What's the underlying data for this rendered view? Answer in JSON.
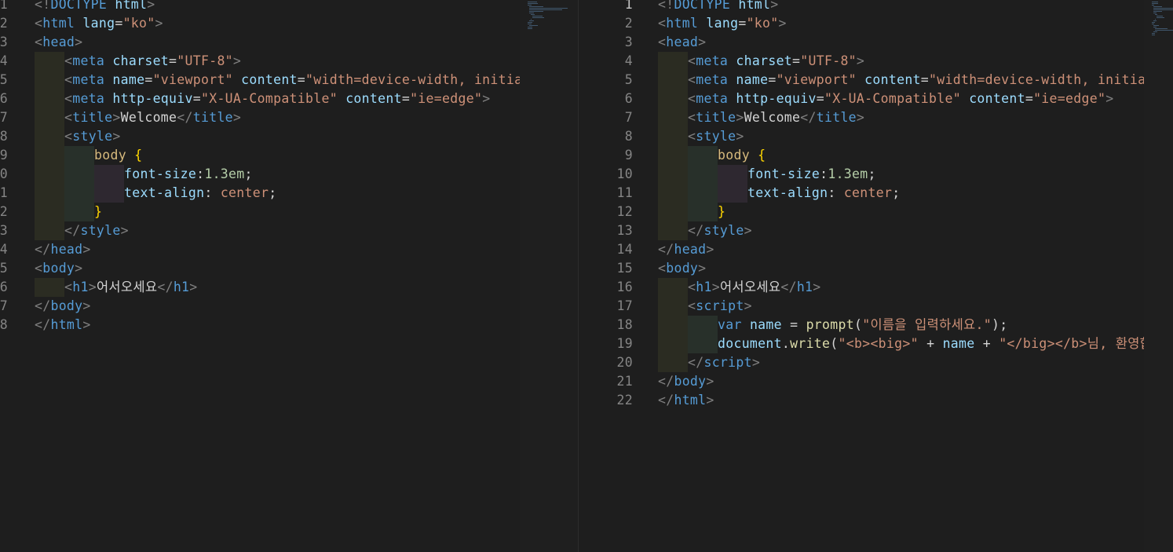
{
  "left_editor": {
    "lines": [
      {
        "no": "1",
        "indent": 0,
        "tokens": [
          [
            "t",
            "<!"
          ],
          [
            "n",
            "DOCTYPE"
          ],
          [
            "x",
            " "
          ],
          [
            "a",
            "html"
          ],
          [
            "t",
            ">"
          ]
        ]
      },
      {
        "no": "2",
        "indent": 0,
        "tokens": [
          [
            "t",
            "<"
          ],
          [
            "n",
            "html"
          ],
          [
            "x",
            " "
          ],
          [
            "a",
            "lang"
          ],
          [
            "x",
            "="
          ],
          [
            "s",
            "\"ko\""
          ],
          [
            "t",
            ">"
          ]
        ]
      },
      {
        "no": "3",
        "indent": 0,
        "tokens": [
          [
            "t",
            "<"
          ],
          [
            "n",
            "head"
          ],
          [
            "t",
            ">"
          ]
        ]
      },
      {
        "no": "4",
        "indent": 1,
        "tokens": [
          [
            "t",
            "<"
          ],
          [
            "n",
            "meta"
          ],
          [
            "x",
            " "
          ],
          [
            "a",
            "charset"
          ],
          [
            "x",
            "="
          ],
          [
            "s",
            "\"UTF-8\""
          ],
          [
            "t",
            ">"
          ]
        ]
      },
      {
        "no": "5",
        "indent": 1,
        "tokens": [
          [
            "t",
            "<"
          ],
          [
            "n",
            "meta"
          ],
          [
            "x",
            " "
          ],
          [
            "a",
            "name"
          ],
          [
            "x",
            "="
          ],
          [
            "s",
            "\"viewport\""
          ],
          [
            "x",
            " "
          ],
          [
            "a",
            "content"
          ],
          [
            "x",
            "="
          ],
          [
            "s",
            "\"width=device-width, initial-sc"
          ]
        ]
      },
      {
        "no": "6",
        "indent": 1,
        "tokens": [
          [
            "t",
            "<"
          ],
          [
            "n",
            "meta"
          ],
          [
            "x",
            " "
          ],
          [
            "a",
            "http-equiv"
          ],
          [
            "x",
            "="
          ],
          [
            "s",
            "\"X-UA-Compatible\""
          ],
          [
            "x",
            " "
          ],
          [
            "a",
            "content"
          ],
          [
            "x",
            "="
          ],
          [
            "s",
            "\"ie=edge\""
          ],
          [
            "t",
            ">"
          ]
        ]
      },
      {
        "no": "7",
        "indent": 1,
        "tokens": [
          [
            "t",
            "<"
          ],
          [
            "n",
            "title"
          ],
          [
            "t",
            ">"
          ],
          [
            "x",
            "Welcome"
          ],
          [
            "t",
            "</"
          ],
          [
            "n",
            "title"
          ],
          [
            "t",
            ">"
          ]
        ]
      },
      {
        "no": "8",
        "indent": 1,
        "tokens": [
          [
            "t",
            "<"
          ],
          [
            "n",
            "style"
          ],
          [
            "t",
            ">"
          ]
        ]
      },
      {
        "no": "9",
        "indent": 2,
        "tokens": [
          [
            "y",
            "body"
          ],
          [
            "x",
            " "
          ],
          [
            "b",
            "{"
          ]
        ]
      },
      {
        "no": "0",
        "indent": 3,
        "tokens": [
          [
            "a",
            "font-size"
          ],
          [
            "x",
            ":"
          ],
          [
            "m",
            "1.3em"
          ],
          [
            "x",
            ";"
          ]
        ]
      },
      {
        "no": "1",
        "indent": 3,
        "tokens": [
          [
            "a",
            "text-align"
          ],
          [
            "x",
            ": "
          ],
          [
            "s",
            "center"
          ],
          [
            "x",
            ";"
          ]
        ]
      },
      {
        "no": "2",
        "indent": 2,
        "tokens": [
          [
            "b",
            "}"
          ]
        ]
      },
      {
        "no": "3",
        "indent": 1,
        "tokens": [
          [
            "t",
            "</"
          ],
          [
            "n",
            "style"
          ],
          [
            "t",
            ">"
          ]
        ]
      },
      {
        "no": "4",
        "indent": 0,
        "tokens": [
          [
            "t",
            "</"
          ],
          [
            "n",
            "head"
          ],
          [
            "t",
            ">"
          ]
        ]
      },
      {
        "no": "5",
        "indent": 0,
        "tokens": [
          [
            "t",
            "<"
          ],
          [
            "n",
            "body"
          ],
          [
            "t",
            ">"
          ]
        ]
      },
      {
        "no": "6",
        "indent": 1,
        "tokens": [
          [
            "t",
            "<"
          ],
          [
            "n",
            "h1"
          ],
          [
            "t",
            ">"
          ],
          [
            "x",
            "어서오세요"
          ],
          [
            "t",
            "</"
          ],
          [
            "n",
            "h1"
          ],
          [
            "t",
            ">"
          ]
        ]
      },
      {
        "no": "7",
        "indent": 0,
        "tokens": [
          [
            "t",
            "</"
          ],
          [
            "n",
            "body"
          ],
          [
            "t",
            ">"
          ]
        ]
      },
      {
        "no": "8",
        "indent": 0,
        "tokens": [
          [
            "t",
            "</"
          ],
          [
            "n",
            "html"
          ],
          [
            "t",
            ">"
          ]
        ]
      }
    ]
  },
  "right_editor": {
    "active_line": "1",
    "lines": [
      {
        "no": "1",
        "indent": 0,
        "tokens": [
          [
            "t",
            "<!"
          ],
          [
            "n",
            "DOCTYPE"
          ],
          [
            "x",
            " "
          ],
          [
            "a",
            "html"
          ],
          [
            "t",
            ">"
          ]
        ]
      },
      {
        "no": "2",
        "indent": 0,
        "tokens": [
          [
            "t",
            "<"
          ],
          [
            "n",
            "html"
          ],
          [
            "x",
            " "
          ],
          [
            "a",
            "lang"
          ],
          [
            "x",
            "="
          ],
          [
            "s",
            "\"ko\""
          ],
          [
            "t",
            ">"
          ]
        ]
      },
      {
        "no": "3",
        "indent": 0,
        "tokens": [
          [
            "t",
            "<"
          ],
          [
            "n",
            "head"
          ],
          [
            "t",
            ">"
          ]
        ]
      },
      {
        "no": "4",
        "indent": 1,
        "tokens": [
          [
            "t",
            "<"
          ],
          [
            "n",
            "meta"
          ],
          [
            "x",
            " "
          ],
          [
            "a",
            "charset"
          ],
          [
            "x",
            "="
          ],
          [
            "s",
            "\"UTF-8\""
          ],
          [
            "t",
            ">"
          ]
        ]
      },
      {
        "no": "5",
        "indent": 1,
        "tokens": [
          [
            "t",
            "<"
          ],
          [
            "n",
            "meta"
          ],
          [
            "x",
            " "
          ],
          [
            "a",
            "name"
          ],
          [
            "x",
            "="
          ],
          [
            "s",
            "\"viewport\""
          ],
          [
            "x",
            " "
          ],
          [
            "a",
            "content"
          ],
          [
            "x",
            "="
          ],
          [
            "s",
            "\"width=device-width, initial-sc"
          ]
        ]
      },
      {
        "no": "6",
        "indent": 1,
        "tokens": [
          [
            "t",
            "<"
          ],
          [
            "n",
            "meta"
          ],
          [
            "x",
            " "
          ],
          [
            "a",
            "http-equiv"
          ],
          [
            "x",
            "="
          ],
          [
            "s",
            "\"X-UA-Compatible\""
          ],
          [
            "x",
            " "
          ],
          [
            "a",
            "content"
          ],
          [
            "x",
            "="
          ],
          [
            "s",
            "\"ie=edge\""
          ],
          [
            "t",
            ">"
          ]
        ]
      },
      {
        "no": "7",
        "indent": 1,
        "tokens": [
          [
            "t",
            "<"
          ],
          [
            "n",
            "title"
          ],
          [
            "t",
            ">"
          ],
          [
            "x",
            "Welcome"
          ],
          [
            "t",
            "</"
          ],
          [
            "n",
            "title"
          ],
          [
            "t",
            ">"
          ]
        ]
      },
      {
        "no": "8",
        "indent": 1,
        "tokens": [
          [
            "t",
            "<"
          ],
          [
            "n",
            "style"
          ],
          [
            "t",
            ">"
          ]
        ]
      },
      {
        "no": "9",
        "indent": 2,
        "tokens": [
          [
            "y",
            "body"
          ],
          [
            "x",
            " "
          ],
          [
            "b",
            "{"
          ]
        ]
      },
      {
        "no": "10",
        "indent": 3,
        "tokens": [
          [
            "a",
            "font-size"
          ],
          [
            "x",
            ":"
          ],
          [
            "m",
            "1.3em"
          ],
          [
            "x",
            ";"
          ]
        ]
      },
      {
        "no": "11",
        "indent": 3,
        "tokens": [
          [
            "a",
            "text-align"
          ],
          [
            "x",
            ": "
          ],
          [
            "s",
            "center"
          ],
          [
            "x",
            ";"
          ]
        ]
      },
      {
        "no": "12",
        "indent": 2,
        "tokens": [
          [
            "b",
            "}"
          ]
        ]
      },
      {
        "no": "13",
        "indent": 1,
        "tokens": [
          [
            "t",
            "</"
          ],
          [
            "n",
            "style"
          ],
          [
            "t",
            ">"
          ]
        ]
      },
      {
        "no": "14",
        "indent": 0,
        "tokens": [
          [
            "t",
            "</"
          ],
          [
            "n",
            "head"
          ],
          [
            "t",
            ">"
          ]
        ]
      },
      {
        "no": "15",
        "indent": 0,
        "tokens": [
          [
            "t",
            "<"
          ],
          [
            "n",
            "body"
          ],
          [
            "t",
            ">"
          ]
        ]
      },
      {
        "no": "16",
        "indent": 1,
        "tokens": [
          [
            "t",
            "<"
          ],
          [
            "n",
            "h1"
          ],
          [
            "t",
            ">"
          ],
          [
            "x",
            "어서오세요"
          ],
          [
            "t",
            "</"
          ],
          [
            "n",
            "h1"
          ],
          [
            "t",
            ">"
          ]
        ]
      },
      {
        "no": "17",
        "indent": 1,
        "tokens": [
          [
            "t",
            "<"
          ],
          [
            "n",
            "script"
          ],
          [
            "t",
            ">"
          ]
        ]
      },
      {
        "no": "18",
        "indent": 2,
        "tokens": [
          [
            "n",
            "var"
          ],
          [
            "x",
            " "
          ],
          [
            "a",
            "name"
          ],
          [
            "x",
            " = "
          ],
          [
            "f",
            "prompt"
          ],
          [
            "x",
            "("
          ],
          [
            "s",
            "\"이름을 입력하세요.\""
          ],
          [
            "x",
            ");"
          ]
        ]
      },
      {
        "no": "19",
        "indent": 2,
        "tokens": [
          [
            "a",
            "document"
          ],
          [
            "x",
            "."
          ],
          [
            "f",
            "write"
          ],
          [
            "x",
            "("
          ],
          [
            "s",
            "\"<b><big>\""
          ],
          [
            "x",
            " + "
          ],
          [
            "a",
            "name"
          ],
          [
            "x",
            " + "
          ],
          [
            "s",
            "\"</big></b>님, 환영합니"
          ]
        ]
      },
      {
        "no": "20",
        "indent": 1,
        "tokens": [
          [
            "t",
            "</"
          ],
          [
            "n",
            "script"
          ],
          [
            "t",
            ">"
          ]
        ]
      },
      {
        "no": "21",
        "indent": 0,
        "tokens": [
          [
            "t",
            "</"
          ],
          [
            "n",
            "body"
          ],
          [
            "t",
            ">"
          ]
        ]
      },
      {
        "no": "22",
        "indent": 0,
        "tokens": [
          [
            "t",
            "</"
          ],
          [
            "n",
            "html"
          ],
          [
            "t",
            ">"
          ]
        ]
      }
    ]
  },
  "icons": {
    "left_minimap": "minimap",
    "right_minimap": "minimap"
  },
  "colors": {
    "background": "#1e1e1e",
    "tag_bracket": "#808080",
    "tag_name": "#569cd6",
    "attribute": "#9cdcfe",
    "string": "#ce9178",
    "text": "#d4d4d4",
    "css_selector": "#d7ba7d",
    "brace": "#ffd700",
    "number": "#b5cea8",
    "function": "#dcdcaa"
  }
}
